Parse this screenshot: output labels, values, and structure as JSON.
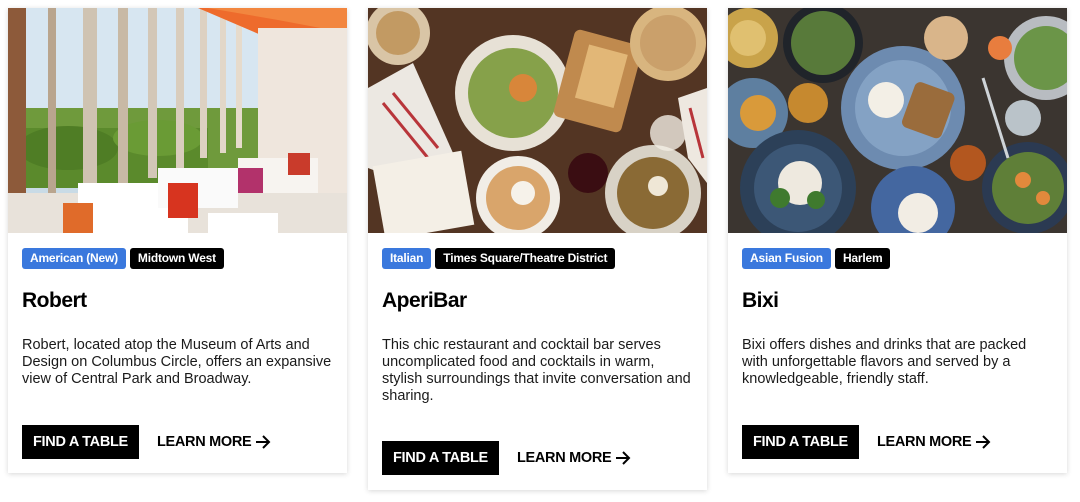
{
  "cards": [
    {
      "cuisine": "American (New)",
      "neighborhood": "Midtown West",
      "name": "Robert",
      "description": "Robert, located atop the Museum of Arts and Design on Columbus Circle, offers an expansive view of Central Park and Broadway.",
      "cta_primary": "FIND A TABLE",
      "cta_secondary": "LEARN MORE"
    },
    {
      "cuisine": "Italian",
      "neighborhood": "Times Square/Theatre District",
      "name": "AperiBar",
      "description": "This chic restaurant and cocktail bar serves uncomplicated food and cocktails in warm, stylish surroundings that invite conversation and sharing.",
      "cta_primary": "FIND A TABLE",
      "cta_secondary": "LEARN MORE"
    },
    {
      "cuisine": "Asian Fusion",
      "neighborhood": "Harlem",
      "name": "Bixi",
      "description": "Bixi offers dishes and drinks that are packed with unforgettable flavors and served by a knowledgeable, friendly staff.",
      "cta_primary": "FIND A TABLE",
      "cta_secondary": "LEARN MORE"
    }
  ],
  "colors": {
    "cuisine_tag": "#3a78dd",
    "neighborhood_tag": "#000000",
    "button": "#000000"
  },
  "icons": {
    "learn_more": "arrow-right-icon"
  }
}
